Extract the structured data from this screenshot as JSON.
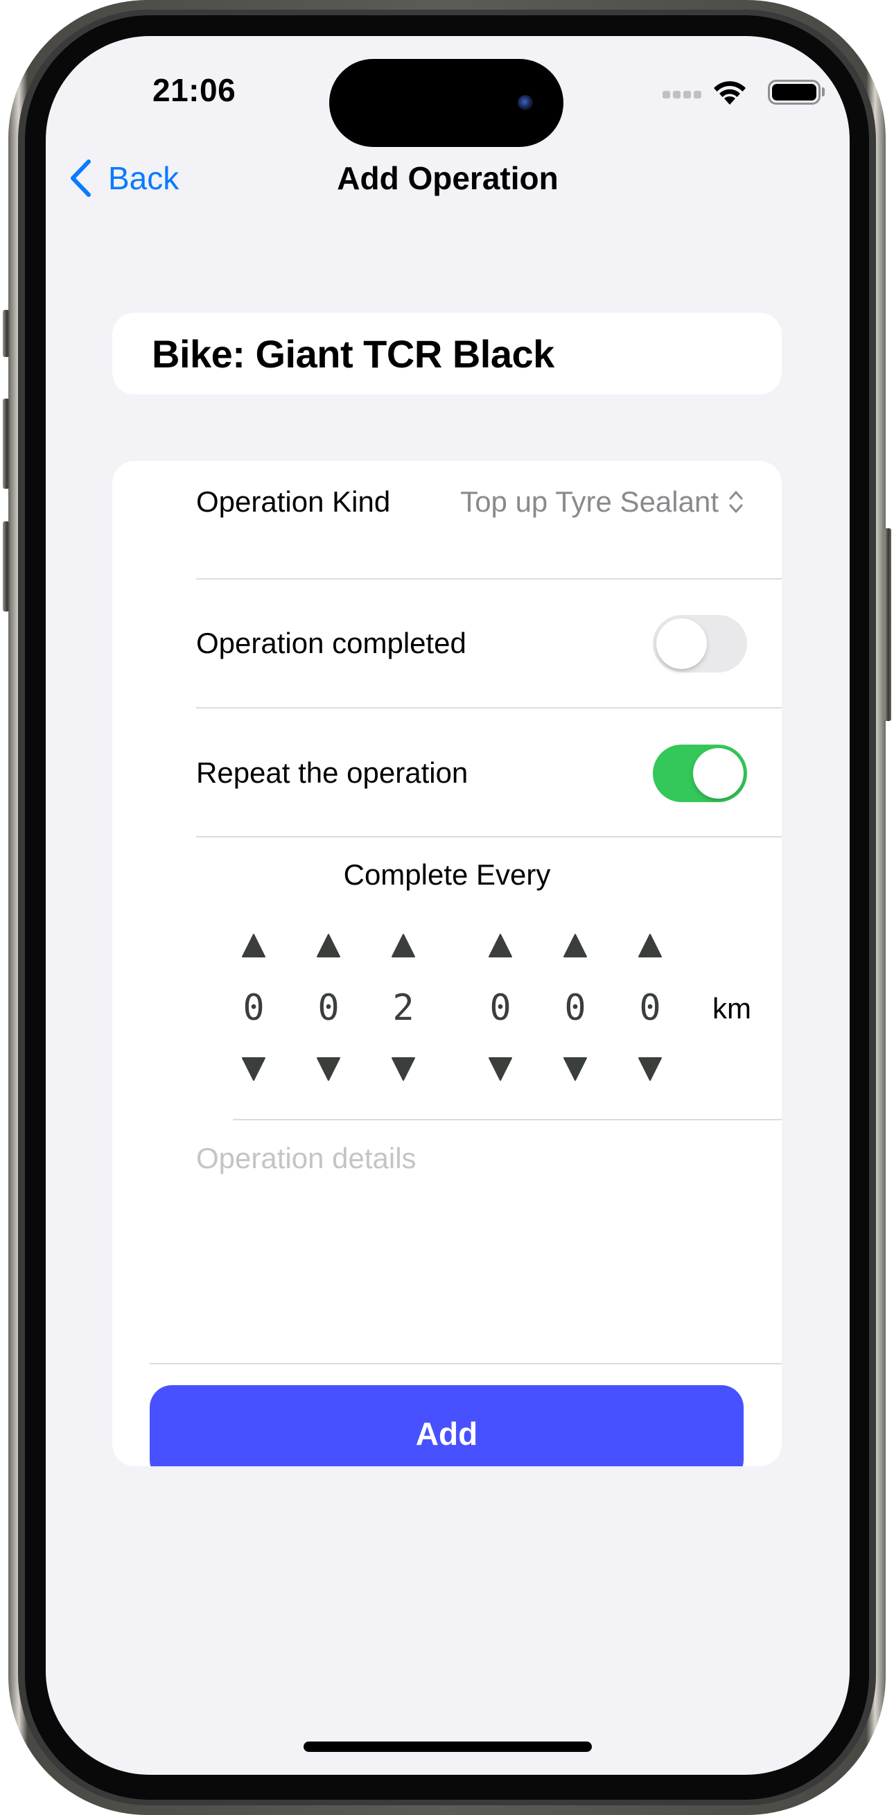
{
  "status_bar": {
    "time": "21:06",
    "icons": [
      "cellular-signal-icon",
      "wifi-icon",
      "battery-icon"
    ]
  },
  "nav": {
    "back_label": "Back",
    "back_icon": "chevron-left-icon",
    "title": "Add Operation"
  },
  "bike_card": {
    "title": "Bike: Giant TCR Black"
  },
  "form": {
    "operation_kind": {
      "label": "Operation Kind",
      "value": "Top up Tyre Sealant",
      "icon": "chevron-up-down-icon"
    },
    "operation_completed": {
      "label": "Operation completed",
      "on": false
    },
    "repeat_operation": {
      "label": "Repeat the operation",
      "on": true
    },
    "complete_every": {
      "label": "Complete Every",
      "digits": [
        "0",
        "0",
        "2",
        "0",
        "0",
        "0"
      ],
      "unit": "km"
    },
    "details": {
      "placeholder": "Operation details",
      "value": ""
    },
    "add_label": "Add"
  },
  "colors": {
    "accent_blue": "#0A7AFF",
    "add_button": "#4851FF",
    "toggle_on": "#34C759",
    "toggle_off": "#E9E9EB",
    "background": "#F2F2F7"
  }
}
